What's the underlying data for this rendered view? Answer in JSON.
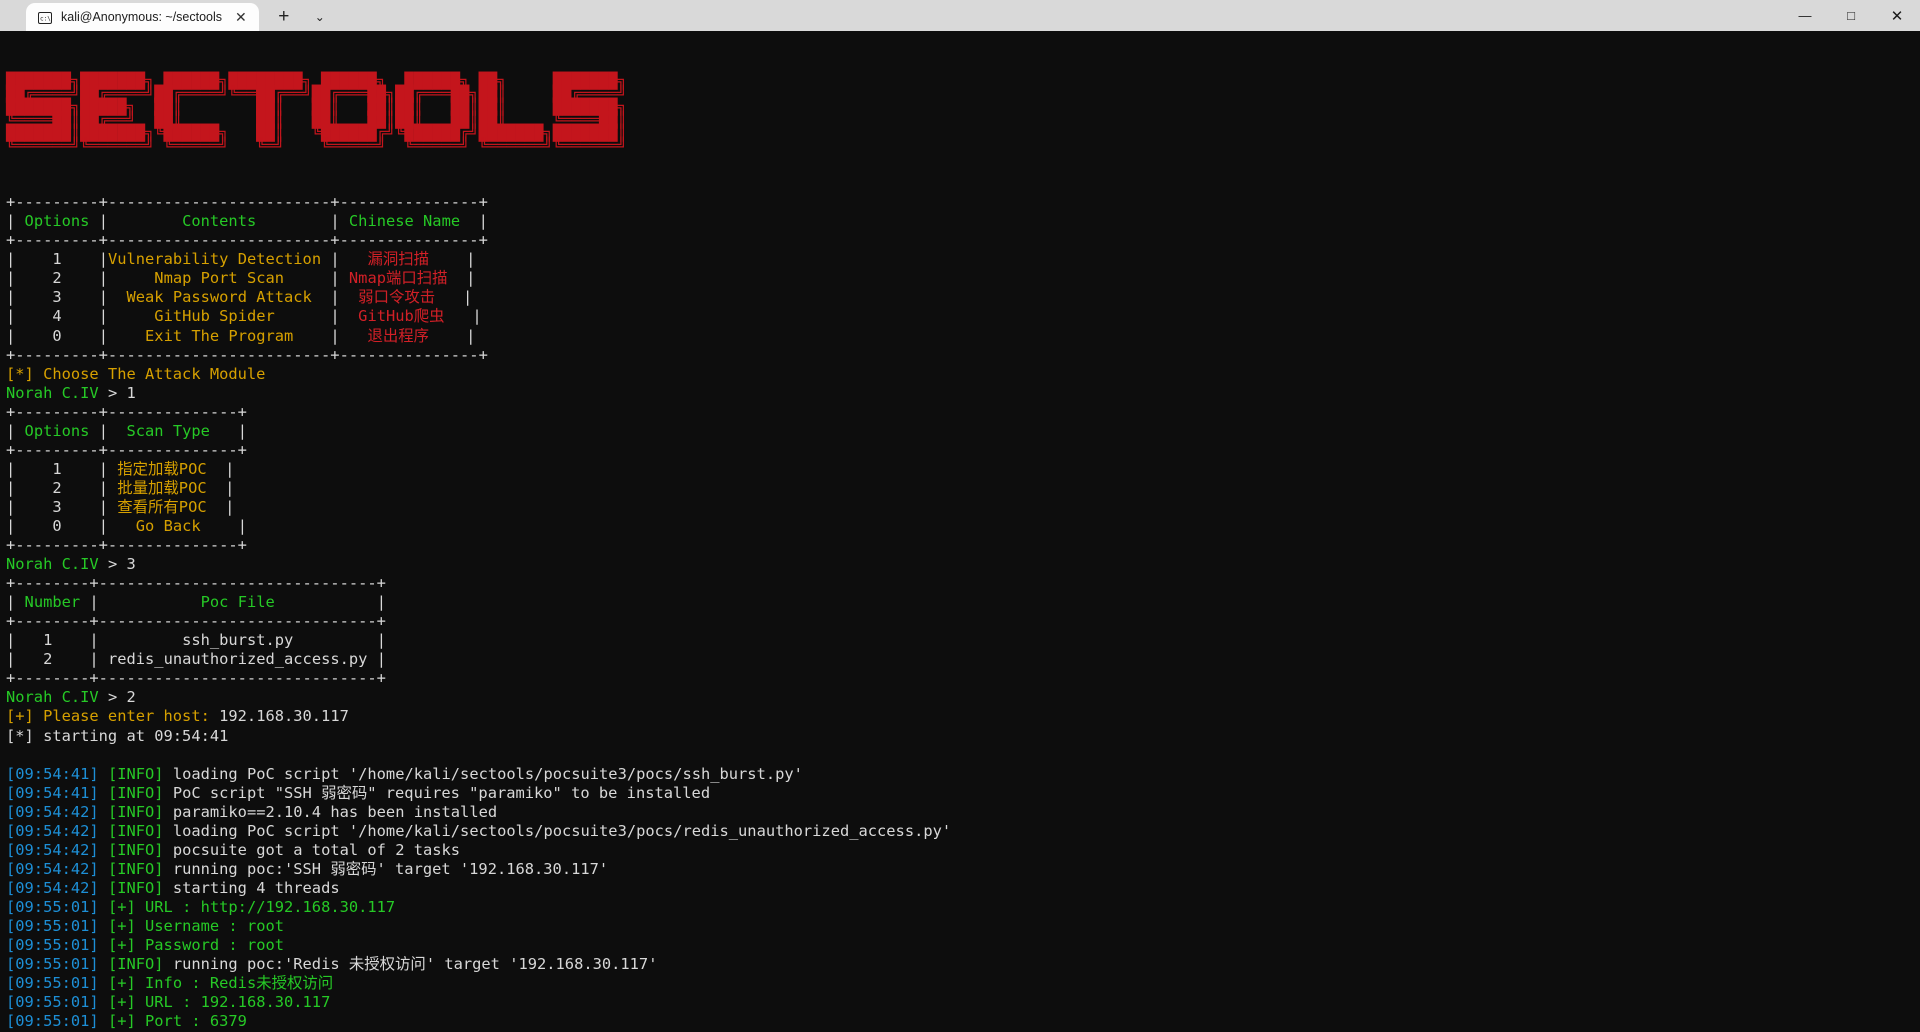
{
  "window": {
    "tab_title": "kali@Anonymous: ~/sectools",
    "tab_icon": "terminal-icon",
    "close_tab_glyph": "✕",
    "new_tab_glyph": "+",
    "tab_list_glyph": "⌄",
    "minimize_glyph": "—",
    "maximize_glyph": "□",
    "close_glyph": "✕"
  },
  "colors": {
    "background": "#0d0d0d",
    "logo_red": "#c4151c",
    "green": "#26c926",
    "yellow": "#d6a000",
    "red": "#d22027",
    "cyan": "#1d8fd6",
    "white": "#d8d8d8",
    "titlebar": "#d9d9d9"
  },
  "logo": {
    "name": "SECTOOLS",
    "ascii": "███████╗███████╗ ██████╗████████╗ ██████╗  ██████╗ ██╗     ███████╗\n██╔════╝██╔════╝██╔════╝╚══██╔══╝██╔═══██╗██╔═══██╗██║     ██╔════╝\n███████╗█████╗  ██║        ██║   ██║   ██║██║   ██║██║     ███████╗\n╚════██║██╔══╝  ██║        ██║   ██║   ██║██║   ██║██║     ╚════██║\n███████║███████╗╚██████╗   ██║   ╚██████╔╝╚██████╔╝███████╗███████║\n╚══════╝╚══════╝ ╚═════╝   ╚═╝    ╚═════╝  ╚═════╝ ╚══════╝╚══════╝"
  },
  "main_menu": {
    "rule": "+---------+------------------------+---------------+",
    "headers": [
      "Options",
      "Contents",
      "Chinese Name"
    ],
    "rows": [
      {
        "option": "1",
        "content": "Vulnerability Detection",
        "chinese": "漏洞扫描"
      },
      {
        "option": "2",
        "content": "Nmap Port Scan",
        "chinese": "Nmap端口扫描"
      },
      {
        "option": "3",
        "content": "Weak Password Attack",
        "chinese": "弱口令攻击"
      },
      {
        "option": "4",
        "content": "GitHub Spider",
        "chinese": "GitHub爬虫"
      },
      {
        "option": "0",
        "content": "Exit The Program",
        "chinese": "退出程序"
      }
    ]
  },
  "prompts": {
    "choose_module": "[*] Choose The Attack Module",
    "prompt_label": "Norah C.IV",
    "prompt_arrow": ">",
    "input_module": "1",
    "input_scan_type": "3",
    "input_poc": "2",
    "please_enter_host_label": "[+] Please enter host:",
    "host_value": "192.168.30.117",
    "starting_at": "[*] starting at 09:54:41"
  },
  "scan_menu": {
    "rule": "+---------+--------------+",
    "headers": [
      "Options",
      "Scan Type"
    ],
    "rows": [
      {
        "option": "1",
        "type": "指定加载POC"
      },
      {
        "option": "2",
        "type": "批量加载POC"
      },
      {
        "option": "3",
        "type": "查看所有POC"
      },
      {
        "option": "0",
        "type": "Go Back"
      }
    ]
  },
  "poc_table": {
    "rule": "+--------+----------------------------+",
    "headers": [
      "Number",
      "Poc File"
    ],
    "rows": [
      {
        "number": "1",
        "file": "ssh_burst.py"
      },
      {
        "number": "2",
        "file": "redis_unauthorized_access.py"
      }
    ]
  },
  "log": [
    {
      "time": "[09:54:41]",
      "level": "[INFO]",
      "level_color": "green",
      "msg": "loading PoC script '/home/kali/sectools/pocsuite3/pocs/ssh_burst.py'"
    },
    {
      "time": "[09:54:41]",
      "level": "[INFO]",
      "level_color": "green",
      "msg": "PoC script \"SSH 弱密码\" requires \"paramiko\" to be installed"
    },
    {
      "time": "[09:54:42]",
      "level": "[INFO]",
      "level_color": "green",
      "msg": "paramiko==2.10.4 has been installed"
    },
    {
      "time": "[09:54:42]",
      "level": "[INFO]",
      "level_color": "green",
      "msg": "loading PoC script '/home/kali/sectools/pocsuite3/pocs/redis_unauthorized_access.py'"
    },
    {
      "time": "[09:54:42]",
      "level": "[INFO]",
      "level_color": "green",
      "msg": "pocsuite got a total of 2 tasks"
    },
    {
      "time": "[09:54:42]",
      "level": "[INFO]",
      "level_color": "green",
      "msg": "running poc:'SSH 弱密码' target '192.168.30.117'"
    },
    {
      "time": "[09:54:42]",
      "level": "[INFO]",
      "level_color": "green",
      "msg": "starting 4 threads"
    },
    {
      "time": "[09:55:01]",
      "level": "[+]",
      "level_color": "green",
      "msg": "URL : http://192.168.30.117",
      "msg_green": true
    },
    {
      "time": "[09:55:01]",
      "level": "[+]",
      "level_color": "green",
      "msg": "Username : root",
      "msg_green": true
    },
    {
      "time": "[09:55:01]",
      "level": "[+]",
      "level_color": "green",
      "msg": "Password : root",
      "msg_green": true
    },
    {
      "time": "[09:55:01]",
      "level": "[INFO]",
      "level_color": "green",
      "msg": "running poc:'Redis 未授权访问' target '192.168.30.117'"
    },
    {
      "time": "[09:55:01]",
      "level": "[+]",
      "level_color": "green",
      "msg": "Info : Redis未授权访问",
      "msg_green": true
    },
    {
      "time": "[09:55:01]",
      "level": "[+]",
      "level_color": "green",
      "msg": "URL : 192.168.30.117",
      "msg_green": true
    },
    {
      "time": "[09:55:01]",
      "level": "[+]",
      "level_color": "green",
      "msg": "Port : 6379",
      "msg_green": true
    }
  ]
}
